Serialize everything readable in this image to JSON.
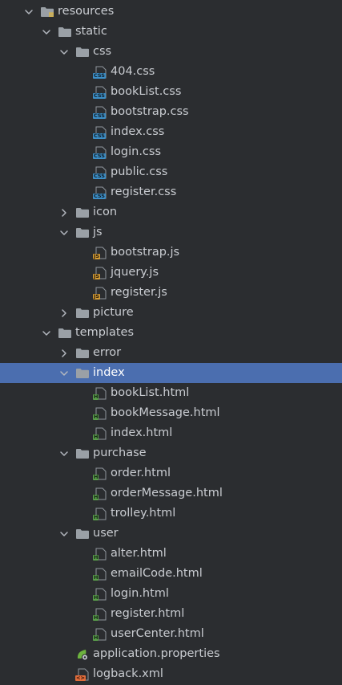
{
  "colors": {
    "background": "#2b2d30",
    "selected": "#4b6eaf",
    "text": "#c9ccd1",
    "folder": "#9aa0a6",
    "css": "#3d8fc7",
    "js": "#d19a35",
    "html": "#5a9e4b",
    "properties": "#6db33f",
    "xml": "#e06c3a"
  },
  "tree": [
    {
      "depth": 0,
      "type": "folder",
      "label": "resources",
      "expanded": true,
      "special": "resources",
      "icon": "resources-folder-icon"
    },
    {
      "depth": 1,
      "type": "folder",
      "label": "static",
      "expanded": true,
      "icon": "folder-icon"
    },
    {
      "depth": 2,
      "type": "folder",
      "label": "css",
      "expanded": true,
      "icon": "folder-icon"
    },
    {
      "depth": 3,
      "type": "css",
      "label": "404.css",
      "icon": "css-file-icon"
    },
    {
      "depth": 3,
      "type": "css",
      "label": "bookList.css",
      "icon": "css-file-icon"
    },
    {
      "depth": 3,
      "type": "css",
      "label": "bootstrap.css",
      "icon": "css-file-icon"
    },
    {
      "depth": 3,
      "type": "css",
      "label": "index.css",
      "icon": "css-file-icon"
    },
    {
      "depth": 3,
      "type": "css",
      "label": "login.css",
      "icon": "css-file-icon"
    },
    {
      "depth": 3,
      "type": "css",
      "label": "public.css",
      "icon": "css-file-icon"
    },
    {
      "depth": 3,
      "type": "css",
      "label": "register.css",
      "icon": "css-file-icon"
    },
    {
      "depth": 2,
      "type": "folder",
      "label": "icon",
      "expanded": false,
      "icon": "folder-icon"
    },
    {
      "depth": 2,
      "type": "folder",
      "label": "js",
      "expanded": true,
      "icon": "folder-icon"
    },
    {
      "depth": 3,
      "type": "js",
      "label": "bootstrap.js",
      "icon": "js-file-icon"
    },
    {
      "depth": 3,
      "type": "js",
      "label": "jquery.js",
      "icon": "js-file-icon"
    },
    {
      "depth": 3,
      "type": "js",
      "label": "register.js",
      "icon": "js-file-icon"
    },
    {
      "depth": 2,
      "type": "folder",
      "label": "picture",
      "expanded": false,
      "icon": "folder-icon"
    },
    {
      "depth": 1,
      "type": "folder",
      "label": "templates",
      "expanded": true,
      "icon": "folder-icon"
    },
    {
      "depth": 2,
      "type": "folder",
      "label": "error",
      "expanded": false,
      "icon": "folder-icon"
    },
    {
      "depth": 2,
      "type": "folder",
      "label": "index",
      "expanded": true,
      "selected": true,
      "icon": "folder-icon"
    },
    {
      "depth": 3,
      "type": "html",
      "label": "bookList.html",
      "icon": "html-file-icon"
    },
    {
      "depth": 3,
      "type": "html",
      "label": "bookMessage.html",
      "icon": "html-file-icon"
    },
    {
      "depth": 3,
      "type": "html",
      "label": "index.html",
      "icon": "html-file-icon"
    },
    {
      "depth": 2,
      "type": "folder",
      "label": "purchase",
      "expanded": true,
      "icon": "folder-icon"
    },
    {
      "depth": 3,
      "type": "html",
      "label": "order.html",
      "icon": "html-file-icon"
    },
    {
      "depth": 3,
      "type": "html",
      "label": "orderMessage.html",
      "icon": "html-file-icon"
    },
    {
      "depth": 3,
      "type": "html",
      "label": "trolley.html",
      "icon": "html-file-icon"
    },
    {
      "depth": 2,
      "type": "folder",
      "label": "user",
      "expanded": true,
      "icon": "folder-icon"
    },
    {
      "depth": 3,
      "type": "html",
      "label": "alter.html",
      "icon": "html-file-icon"
    },
    {
      "depth": 3,
      "type": "html",
      "label": "emailCode.html",
      "icon": "html-file-icon"
    },
    {
      "depth": 3,
      "type": "html",
      "label": "login.html",
      "icon": "html-file-icon"
    },
    {
      "depth": 3,
      "type": "html",
      "label": "register.html",
      "icon": "html-file-icon"
    },
    {
      "depth": 3,
      "type": "html",
      "label": "userCenter.html",
      "icon": "html-file-icon"
    },
    {
      "depth": 2,
      "type": "properties",
      "label": "application.properties",
      "icon": "properties-file-icon"
    },
    {
      "depth": 2,
      "type": "xml",
      "label": "logback.xml",
      "icon": "xml-file-icon"
    }
  ]
}
